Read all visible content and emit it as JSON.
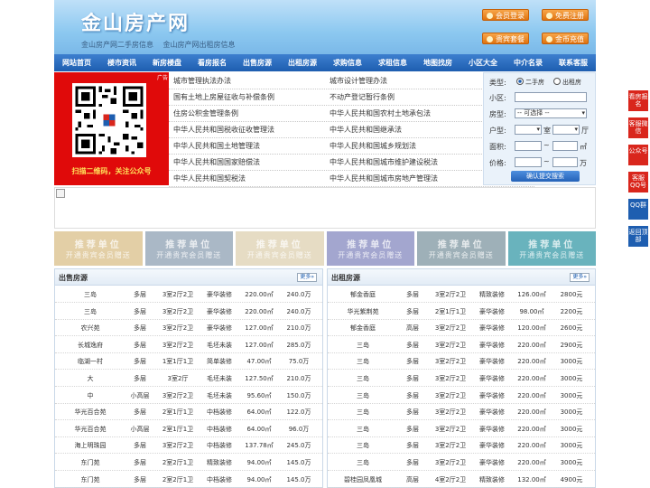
{
  "header": {
    "logo": "金山房产网",
    "sub1": "金山房产网二手房信息",
    "sub2": "金山房产网出租房信息",
    "btn_login": "会员登录",
    "btn_register": "免费注册",
    "btn_vip": "贵宾套餐",
    "btn_coin": "金币充值"
  },
  "nav": [
    "网站首页",
    "楼市资讯",
    "新房楼盘",
    "看房报名",
    "出售房源",
    "出租房源",
    "求购信息",
    "求租信息",
    "地图找房",
    "小区大全",
    "中介名录",
    "联系客服"
  ],
  "qr": {
    "ad": "广告",
    "caption": "扫描二维码，关注公众号"
  },
  "links": [
    [
      "城市管理执法办法",
      "城市设计管理办法"
    ],
    [
      "国有土地上房屋征收与补偿条例",
      "不动产登记暂行条例"
    ],
    [
      "住房公积金管理条例",
      "中华人民共和国农村土地承包法"
    ],
    [
      "中华人民共和国税收征收管理法",
      "中华人民共和国继承法"
    ],
    [
      "中华人民共和国土地管理法",
      "中华人民共和国城乡规划法"
    ],
    [
      "中华人民共和国国家赔偿法",
      "中华人民共和国城市维护建设税法"
    ],
    [
      "中华人民共和国契税法",
      "中华人民共和国城市房地产管理法"
    ]
  ],
  "search": {
    "type_label": "类型:",
    "opt_sale": "二手房",
    "opt_rent": "出租房",
    "area_label": "小区:",
    "style_label": "房型:",
    "style_value": "-- 可选择 --",
    "layout_label": "户型:",
    "room_unit": "室",
    "hall_unit": "厅",
    "size_label": "面积:",
    "size_unit": "㎡",
    "price_label": "价格:",
    "price_unit": "万",
    "tilde": "~",
    "submit": "确认提交搜索"
  },
  "units": [
    {
      "t1": "推荐单位",
      "t2": "开通贵宾会员赠送",
      "color": "#e3cfa6"
    },
    {
      "t1": "推荐单位",
      "t2": "开通贵宾会员赠送",
      "color": "#aab8c6"
    },
    {
      "t1": "推荐单位",
      "t2": "开通贵宾会员赠送",
      "color": "#e6dcc4"
    },
    {
      "t1": "推荐单位",
      "t2": "开通贵宾会员赠送",
      "color": "#a3a6cf"
    },
    {
      "t1": "推荐单位",
      "t2": "开通贵宾会员赠送",
      "color": "#9eb0b8"
    },
    {
      "t1": "推荐单位",
      "t2": "开通贵宾会员赠送",
      "color": "#69b3bd"
    }
  ],
  "sale": {
    "title": "出售房源",
    "more": "更多»",
    "rows": [
      [
        "三岛",
        "多层",
        "3室2厅2卫",
        "豪华装修",
        "220.00㎡",
        "240.0万"
      ],
      [
        "三岛",
        "多层",
        "3室2厅2卫",
        "豪华装修",
        "220.00㎡",
        "240.0万"
      ],
      [
        "农兴苑",
        "多层",
        "3室2厅2卫",
        "豪华装修",
        "127.00㎡",
        "210.0万"
      ],
      [
        "长城逸府",
        "多层",
        "3室2厅2卫",
        "毛坯未装",
        "127.00㎡",
        "285.0万"
      ],
      [
        "临湖一村",
        "多层",
        "1室1厅1卫",
        "简单装修",
        "47.00㎡",
        "75.0万"
      ],
      [
        "大",
        "多层",
        "3室2厅",
        "毛坯未装",
        "127.50㎡",
        "210.0万"
      ],
      [
        "中",
        "小高层",
        "3室2厅2卫",
        "毛坯未装",
        "95.60㎡",
        "150.0万"
      ],
      [
        "华光百合苑",
        "多层",
        "2室1厅1卫",
        "中档装修",
        "64.00㎡",
        "122.0万"
      ],
      [
        "华光百合苑",
        "小高层",
        "2室1厅1卫",
        "中档装修",
        "64.00㎡",
        "96.0万"
      ],
      [
        "海上明珠园",
        "多层",
        "3室2厅2卫",
        "中档装修",
        "137.78㎡",
        "245.0万"
      ],
      [
        "东门苑",
        "多层",
        "2室2厅1卫",
        "精致装修",
        "94.00㎡",
        "145.0万"
      ],
      [
        "东门苑",
        "多层",
        "2室2厅1卫",
        "中档装修",
        "94.00㎡",
        "145.0万"
      ]
    ]
  },
  "rent": {
    "title": "出租房源",
    "more": "更多»",
    "rows": [
      [
        "郁金香庭",
        "多层",
        "3室2厅2卫",
        "精致装修",
        "126.00㎡",
        "2800元"
      ],
      [
        "华光紫荆苑",
        "多层",
        "2室1厅1卫",
        "豪华装修",
        "98.00㎡",
        "2200元"
      ],
      [
        "郁金香庭",
        "高层",
        "3室2厅2卫",
        "豪华装修",
        "120.00㎡",
        "2600元"
      ],
      [
        "三岛",
        "多层",
        "3室2厅2卫",
        "豪华装修",
        "220.00㎡",
        "2900元"
      ],
      [
        "三岛",
        "多层",
        "3室2厅2卫",
        "豪华装修",
        "220.00㎡",
        "3000元"
      ],
      [
        "三岛",
        "多层",
        "3室2厅2卫",
        "豪华装修",
        "220.00㎡",
        "3000元"
      ],
      [
        "三岛",
        "多层",
        "3室2厅2卫",
        "豪华装修",
        "220.00㎡",
        "3000元"
      ],
      [
        "三岛",
        "多层",
        "3室2厅2卫",
        "豪华装修",
        "220.00㎡",
        "3000元"
      ],
      [
        "三岛",
        "多层",
        "3室2厅2卫",
        "豪华装修",
        "220.00㎡",
        "3000元"
      ],
      [
        "三岛",
        "多层",
        "3室2厅2卫",
        "豪华装修",
        "220.00㎡",
        "3000元"
      ],
      [
        "三岛",
        "多层",
        "3室2厅2卫",
        "豪华装修",
        "220.00㎡",
        "3000元"
      ],
      [
        "碧桂园凤凰城",
        "高层",
        "4室2厅2卫",
        "精致装修",
        "132.00㎡",
        "4900元"
      ]
    ]
  },
  "side": [
    {
      "label": "看房报名",
      "color": "#d9261c"
    },
    {
      "label": "客服微信",
      "color": "#d9261c"
    },
    {
      "label": "公众号",
      "color": "#d9261c"
    },
    {
      "label": "客服QQ号",
      "color": "#d9261c"
    },
    {
      "label": "QQ群",
      "color": "#1e5eb0"
    },
    {
      "label": "返回顶部",
      "color": "#1e5eb0"
    }
  ]
}
